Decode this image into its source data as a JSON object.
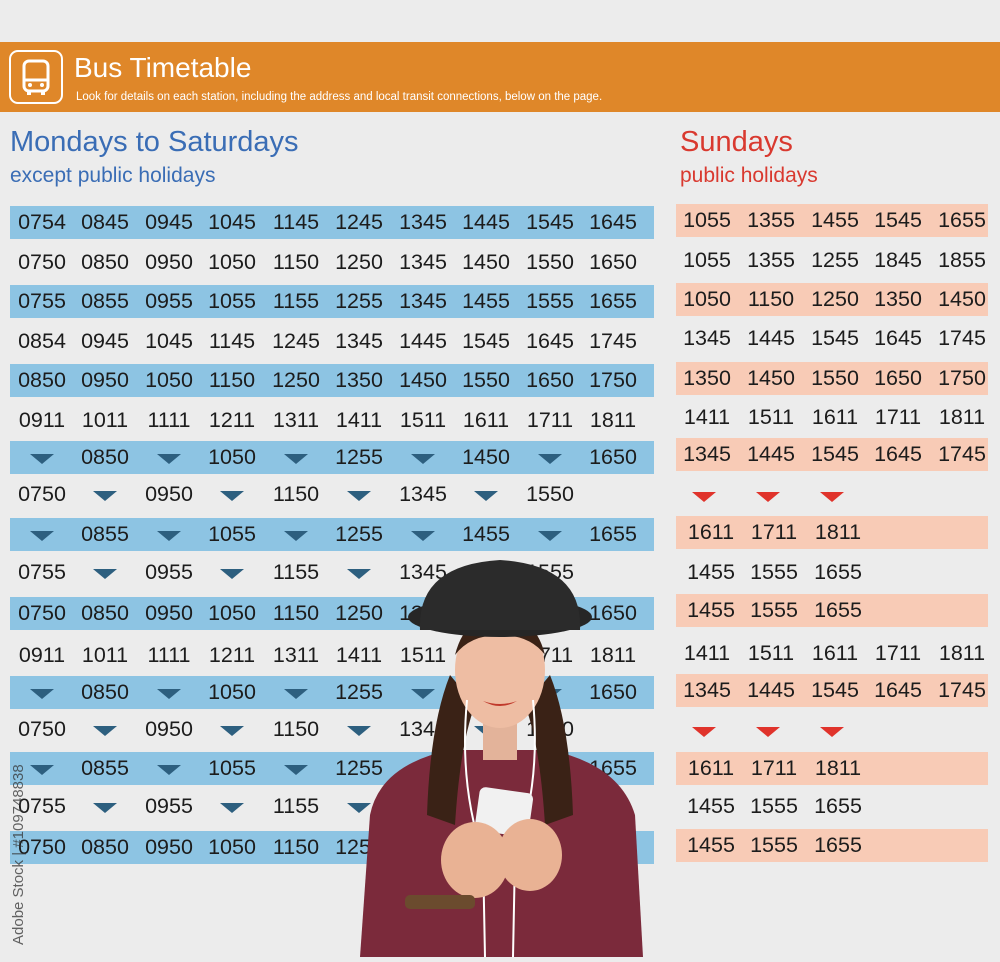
{
  "header": {
    "title": "Bus Timetable",
    "subtitle": "Look for details on each station, including the address and local transit connections, below on the page.",
    "icon": "bus-icon",
    "color": "#df8729"
  },
  "weekday": {
    "heading": "Mondays to Saturdays",
    "subheading": "except public holidays",
    "color": "#3a6db5",
    "rows": [
      [
        "0754",
        "0845",
        "0945",
        "1045",
        "1145",
        "1245",
        "1345",
        "1445",
        "1545",
        "1645"
      ],
      [
        "0750",
        "0850",
        "0950",
        "1050",
        "1150",
        "1250",
        "1345",
        "1450",
        "1550",
        "1650"
      ],
      [
        "0755",
        "0855",
        "0955",
        "1055",
        "1155",
        "1255",
        "1345",
        "1455",
        "1555",
        "1655"
      ],
      [
        "0854",
        "0945",
        "1045",
        "1145",
        "1245",
        "1345",
        "1445",
        "1545",
        "1645",
        "1745"
      ],
      [
        "0850",
        "0950",
        "1050",
        "1150",
        "1250",
        "1350",
        "1450",
        "1550",
        "1650",
        "1750"
      ],
      [
        "0911",
        "1011",
        "1111",
        "1211",
        "1311",
        "1411",
        "1511",
        "1611",
        "1711",
        "1811"
      ],
      [
        "▼",
        "0850",
        "▼",
        "1050",
        "▼",
        "1255",
        "▼",
        "1450",
        "▼",
        "1650"
      ],
      [
        "0750",
        "▼",
        "0950",
        "▼",
        "1150",
        "▼",
        "1345",
        "▼",
        "1550",
        ""
      ],
      [
        "▼",
        "0855",
        "▼",
        "1055",
        "▼",
        "1255",
        "▼",
        "1455",
        "▼",
        "1655"
      ],
      [
        "0755",
        "▼",
        "0955",
        "▼",
        "1155",
        "▼",
        "1345",
        "▼",
        "1555",
        ""
      ],
      [
        "0750",
        "0850",
        "0950",
        "1050",
        "1150",
        "1250",
        "1345",
        "1450",
        "1550",
        "1650"
      ],
      [
        "0911",
        "1011",
        "1111",
        "1211",
        "1311",
        "1411",
        "1511",
        "1611",
        "1711",
        "1811"
      ],
      [
        "▼",
        "0850",
        "▼",
        "1050",
        "▼",
        "1255",
        "▼",
        "1450",
        "▼",
        "1650"
      ],
      [
        "0750",
        "▼",
        "0950",
        "▼",
        "1150",
        "▼",
        "1345",
        "▼",
        "1550",
        ""
      ],
      [
        "▼",
        "0855",
        "▼",
        "1055",
        "▼",
        "1255",
        "▼",
        "1455",
        "▼",
        "1655"
      ],
      [
        "0755",
        "▼",
        "0955",
        "▼",
        "1155",
        "▼",
        "1345",
        "▼",
        "1555",
        ""
      ],
      [
        "0750",
        "0850",
        "0950",
        "1050",
        "1150",
        "1250",
        "1345",
        "1450",
        "1550",
        "1650"
      ]
    ]
  },
  "sunday": {
    "heading": "Sundays",
    "subheading": "public holidays",
    "color": "#d9392f",
    "rows": [
      [
        "1055",
        "1355",
        "1455",
        "1545",
        "1655"
      ],
      [
        "1055",
        "1355",
        "1255",
        "1845",
        "1855"
      ],
      [
        "1050",
        "1150",
        "1250",
        "1350",
        "1450"
      ],
      [
        "1345",
        "1445",
        "1545",
        "1645",
        "1745"
      ],
      [
        "1350",
        "1450",
        "1550",
        "1650",
        "1750"
      ],
      [
        "1411",
        "1511",
        "1611",
        "1711",
        "1811"
      ],
      [
        "1345",
        "1445",
        "1545",
        "1645",
        "1745"
      ],
      [
        "▼",
        "▼",
        "▼"
      ],
      [
        "1611",
        "1711",
        "1811"
      ],
      [
        "1455",
        "1555",
        "1655"
      ],
      [
        "1455",
        "1555",
        "1655"
      ],
      [
        "1411",
        "1511",
        "1611",
        "1711",
        "1811"
      ],
      [
        "1345",
        "1445",
        "1545",
        "1645",
        "1745"
      ],
      [
        "▼",
        "▼",
        "▼"
      ],
      [
        "1611",
        "1711",
        "1811"
      ],
      [
        "1455",
        "1555",
        "1655"
      ],
      [
        "1455",
        "1555",
        "1655"
      ]
    ]
  },
  "watermark": {
    "text": "Adobe Stock | #109748838"
  },
  "colors": {
    "blue_band": "#8dc4e3",
    "pink_band": "#f8cbb6",
    "dark_arrow": "#2d5f7f",
    "red_arrow": "#e0332b"
  }
}
